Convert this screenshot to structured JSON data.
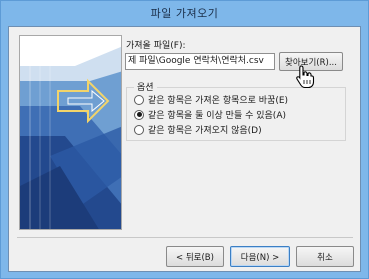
{
  "window": {
    "title": "파일 가져오기"
  },
  "file": {
    "label": "가져올 파일(F):",
    "path_value": "제 파일\\Google 연락처\\연락처.csv",
    "browse_button": "찾아보기(R)..."
  },
  "options": {
    "title": "옵션",
    "items": [
      {
        "label": "같은 항목은 가져온 항목으로 바꿈(E)",
        "selected": false
      },
      {
        "label": "같은 항목을 둘 이상 만들 수 있음(A)",
        "selected": true
      },
      {
        "label": "같은 항목은 가져오지 않음(D)",
        "selected": false
      }
    ]
  },
  "footer": {
    "back_button": "< 뒤로(B)",
    "next_button": "다음(N) >",
    "cancel_button": "취소"
  }
}
